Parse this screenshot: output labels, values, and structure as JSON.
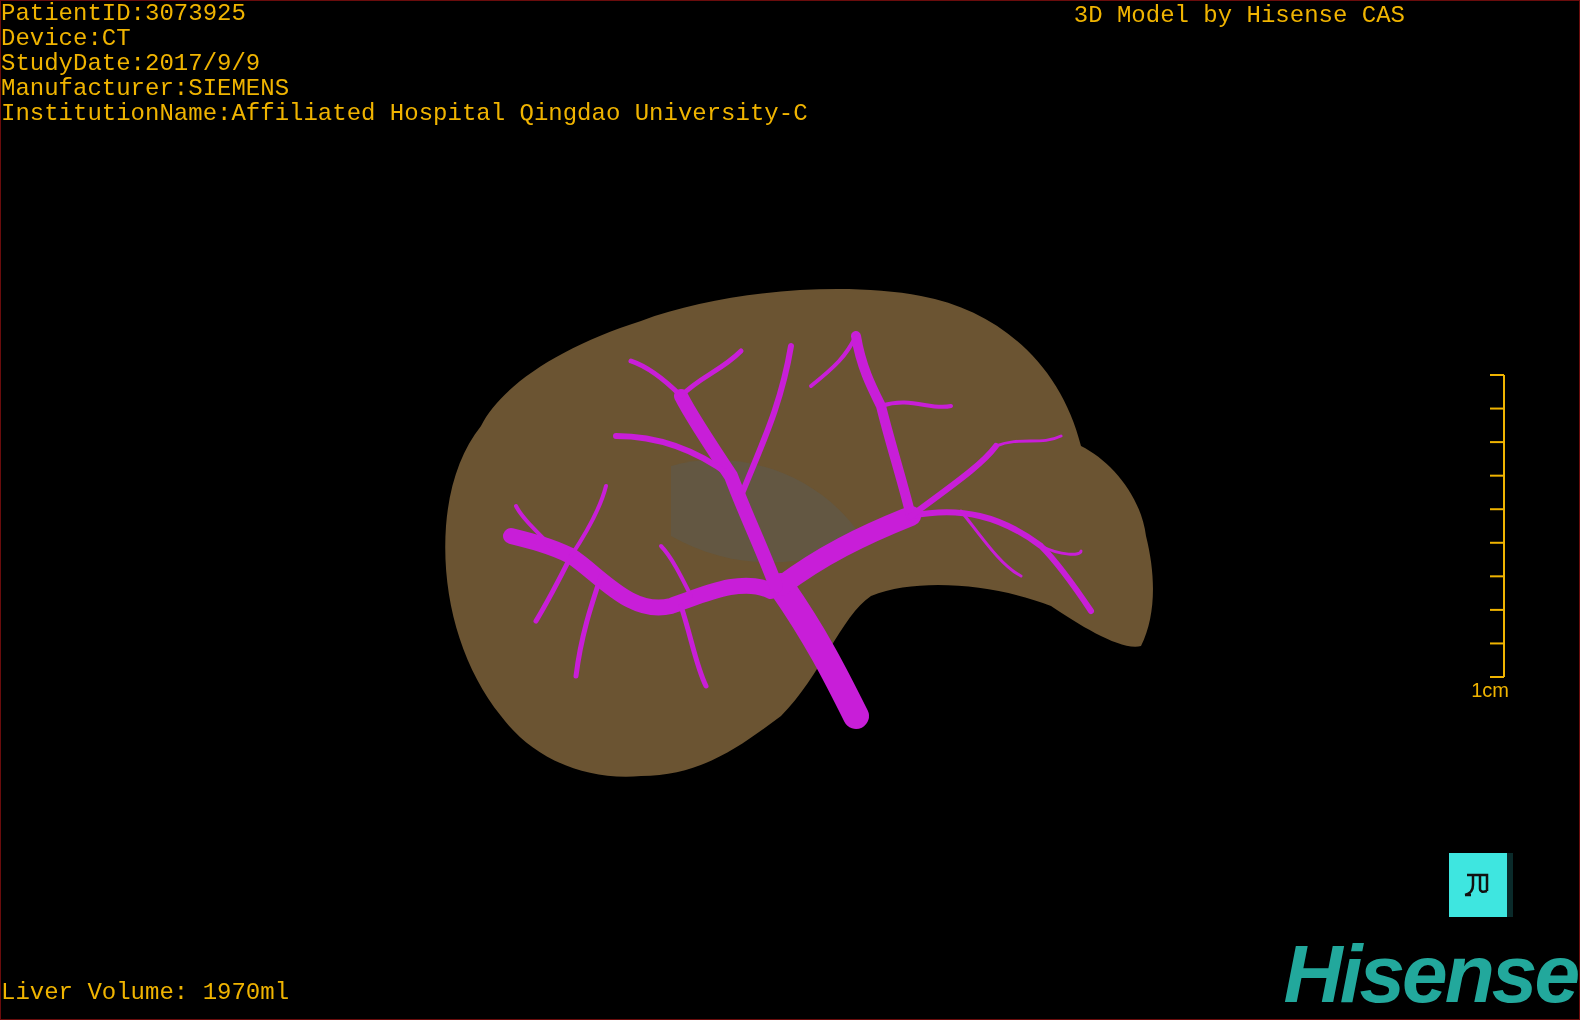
{
  "patient_info": [
    "PatientID:3073925",
    "Device:CT",
    "StudyDate:2017/9/9",
    "Manufacturer:SIEMENS",
    "InstitutionName:Affiliated Hospital Qingdao University-C"
  ],
  "model_credit": "3D Model by Hisense CAS",
  "scale_bar": {
    "label": "1cm"
  },
  "liver_volume": "Liver Volume: 1970ml",
  "logo": "Hisense"
}
